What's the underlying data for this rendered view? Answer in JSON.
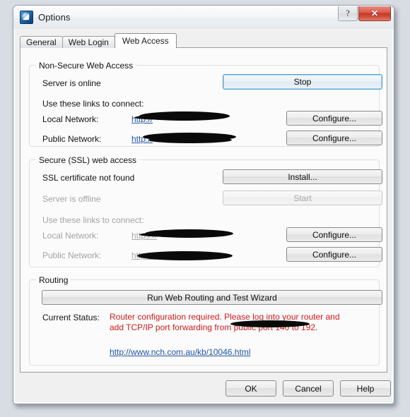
{
  "window": {
    "title": "Options",
    "icon": "app-logo-icon",
    "help_button": "?",
    "close_button": "✕"
  },
  "tabs": [
    {
      "label": "General",
      "active": false
    },
    {
      "label": "Web Login",
      "active": false
    },
    {
      "label": "Web Access",
      "active": true
    }
  ],
  "non_secure": {
    "group_title": "Non-Secure Web Access",
    "server_status": "Server is online",
    "stop_button": "Stop",
    "links_hint": "Use these links to connect:",
    "local_label": "Local Network:",
    "local_url": "http://",
    "local_configure": "Configure...",
    "public_label": "Public Network:",
    "public_url": "http://",
    "public_configure": "Configure..."
  },
  "ssl": {
    "group_title": "Secure (SSL) web access",
    "cert_status": "SSL certificate not found",
    "install_button": "Install...",
    "server_status": "Server is offline",
    "start_button": "Start",
    "links_hint": "Use these links to connect:",
    "local_label": "Local Network:",
    "local_url": "https://",
    "local_configure": "Configure...",
    "public_label": "Public Network:",
    "public_url": "https://",
    "public_configure": "Configure..."
  },
  "routing": {
    "group_title": "Routing",
    "wizard_button": "Run Web Routing and Test Wizard",
    "status_label": "Current Status:",
    "status_text": "Router configuration required. Please log into your router and add TCP/IP port forwarding from public port 140 to 192.",
    "kb_link": "http://www.nch.com.au/kb/10046.html"
  },
  "footer": {
    "ok": "OK",
    "cancel": "Cancel",
    "help": "Help"
  },
  "colors": {
    "accent": "#2255a4",
    "error": "#d01a1a",
    "close_button": "#c4372a",
    "focus_border": "#5c9ccc"
  }
}
